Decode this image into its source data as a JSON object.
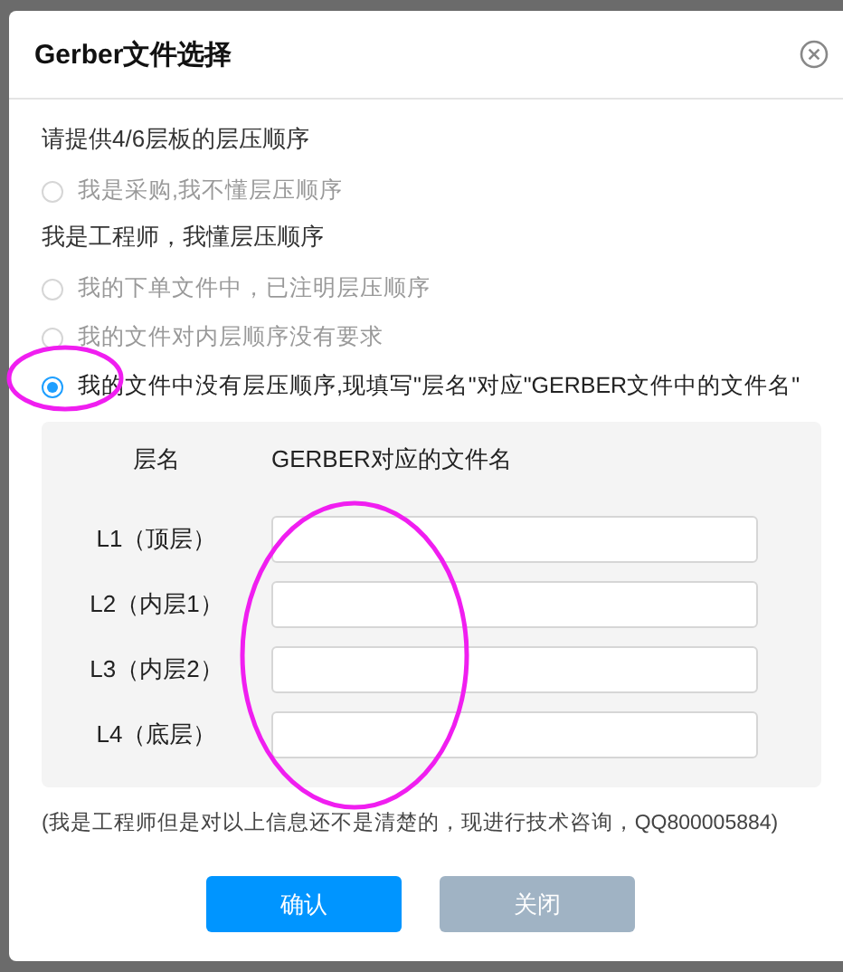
{
  "dialog": {
    "title": "Gerber文件选择",
    "sections": [
      {
        "heading": "请提供4/6层板的层压顺序",
        "options": [
          {
            "label": "我是采购,我不懂层压顺序",
            "selected": false
          }
        ]
      },
      {
        "heading": "我是工程师，我懂层压顺序",
        "options": [
          {
            "label": "我的下单文件中，已注明层压顺序",
            "selected": false
          },
          {
            "label": "我的文件对内层顺序没有要求",
            "selected": false
          },
          {
            "label": "我的文件中没有层压顺序,现填写\"层名\"对应\"GERBER文件中的文件名\"",
            "selected": true
          }
        ]
      }
    ],
    "layer_table": {
      "columns": [
        "层名",
        "GERBER对应的文件名"
      ],
      "rows": [
        {
          "layer": "L1（顶层）"
        },
        {
          "layer": "L2（内层1）"
        },
        {
          "layer": "L3（内层2）"
        },
        {
          "layer": "L4（底层）"
        }
      ]
    },
    "note": "(我是工程师但是对以上信息还不是清楚的，现进行技术咨询，QQ800005884)",
    "buttons": [
      {
        "label": "确认",
        "kind": "primary"
      },
      {
        "label": "关闭",
        "kind": "secondary"
      }
    ]
  }
}
